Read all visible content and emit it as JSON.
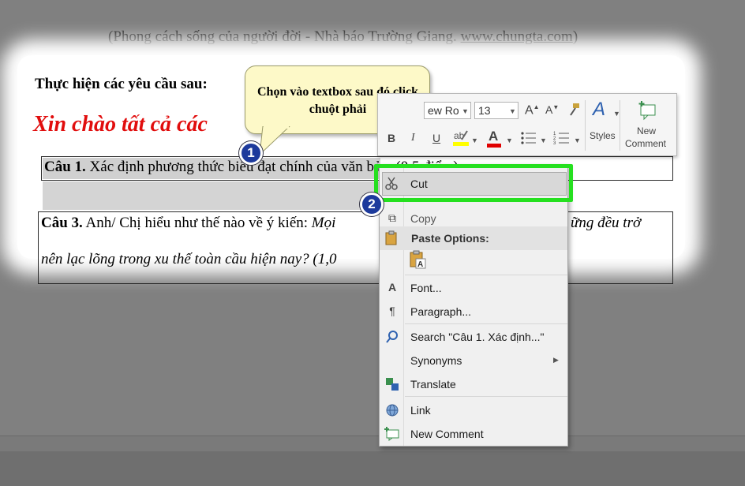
{
  "document": {
    "quote_prefix": "(Phong cách sống của người đời - Nhà báo Trường Giang. ",
    "quote_link": "www.chungta.com",
    "quote_suffix": ")",
    "requirement": "Thực hiện các yêu cầu sau:",
    "heading": "Xin chào tất cả các",
    "q1_label": "Câu 1.",
    "q1_text": " Xác định phương thức biểu đạt chính của văn bản. (0,5 điểm)",
    "q3_label": "Câu 3.",
    "q3_text": " Anh/ Chị hiểu như thế nào về ý kiến: ",
    "q3_italic_start": "Mọi",
    "q3_italic_end": "ững đều trở",
    "q3_line2": "nên lạc lõng trong xu thế toàn cầu hiện nay? (1,0"
  },
  "callout": {
    "text": "Chọn vào textbox sau đó click chuột phải",
    "step1": "1",
    "step2": "2"
  },
  "mini_toolbar": {
    "font_name": "ew Ro",
    "font_size": "13",
    "grow_font": "A",
    "shrink_font": "A",
    "bold": "B",
    "italic": "I",
    "underline": "U",
    "font_color_glyph": "A",
    "styles_label": "Styles",
    "new_comment_line1": "New",
    "new_comment_line2": "Comment"
  },
  "context_menu": {
    "cut": "Cut",
    "copy": "Copy",
    "paste_options": "Paste Options:",
    "font": "Font...",
    "paragraph": "Paragraph...",
    "search": "Search \"Câu 1. Xác định...\"",
    "synonyms": "Synonyms",
    "translate": "Translate",
    "link": "Link",
    "new_comment": "New Comment"
  },
  "colors": {
    "highlight_green": "#25e01f",
    "heading_red": "#e10d0d",
    "badge_blue": "#1d3a9c",
    "callout_yellow": "#fdf9c8"
  }
}
